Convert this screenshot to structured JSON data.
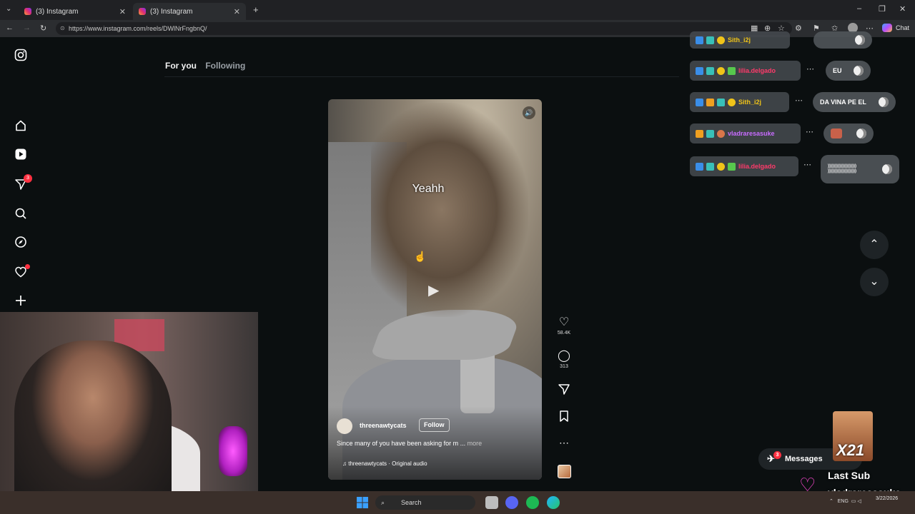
{
  "browser": {
    "tabs": [
      {
        "title": "(3) Instagram",
        "active": false
      },
      {
        "title": "(3) Instagram",
        "active": true
      }
    ],
    "url": "https://www.instagram.com/reels/DWlNrFngbnQ/",
    "chat_label": "Chat"
  },
  "sidebar": {
    "notifications_badge": "3"
  },
  "feed_tabs": {
    "for_you": "For you",
    "following": "Following"
  },
  "reel": {
    "caption_overlay": "Yeahh",
    "author": "threenawtycats",
    "follow_label": "Follow",
    "description": "Since many of you have been asking for m ...",
    "more_label": "more",
    "audio": "threenawtycats · Original audio",
    "likes": "58.4K",
    "comments": "313"
  },
  "messages": {
    "label": "Messages",
    "badge": "3"
  },
  "chat_overlay": {
    "rows": [
      {
        "user": "Sith_i2j",
        "msg": "",
        "user_color": "#f0c419"
      },
      {
        "user": "lilia.delgado",
        "msg": "EU",
        "user_color": "#ff3a6a"
      },
      {
        "user": "Sith_i2j",
        "msg": "DA VINA PE EL",
        "user_color": "#f0c419"
      },
      {
        "user": "vladraresasuke",
        "msg": "",
        "user_color": "#c86cff"
      },
      {
        "user": "lilia.delgado",
        "msg": "))))))))))))))))))))\n))))))))))))))))))))",
        "user_color": "#ff3a6a"
      }
    ]
  },
  "stream_overlay": {
    "last_sub_label": "Last Sub",
    "last_sub_name": "vladraresasuke",
    "combo": "X21"
  },
  "taskbar": {
    "search_placeholder": "Search",
    "lang": "ENG",
    "date": "3/22/2026"
  },
  "colors": {
    "accent_red": "#ff3040",
    "heart_pink": "#ff4ad5"
  }
}
